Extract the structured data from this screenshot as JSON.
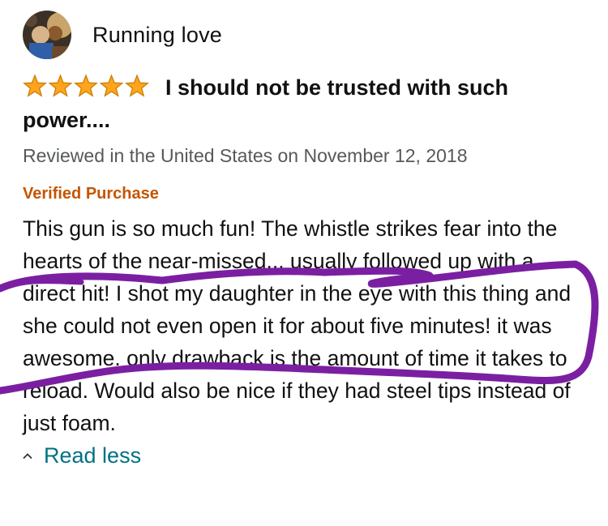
{
  "review": {
    "profile_name": "Running love",
    "rating_stars": 5,
    "rating_color": "#FFA41C",
    "title": "I should not be trusted with such power....",
    "date": "Reviewed in the United States on November 12, 2018",
    "verified_label": "Verified Purchase",
    "verified_color": "#C45500",
    "body": "This gun is so much fun! The whistle strikes fear into the hearts of the near-missed... usually followed up with a direct hit! I shot my daughter in the eye with this thing and she could not even open it for about five minutes! it was awesome. only drawback is the amount of time it takes to reload. Would also be nice if they had steel tips instead of just foam.",
    "read_less_label": "Read less",
    "read_less_icon": "chevron-up-icon",
    "link_color": "#007185"
  },
  "annotation": {
    "type": "hand-drawn circle",
    "color": "#7B1FA2"
  }
}
